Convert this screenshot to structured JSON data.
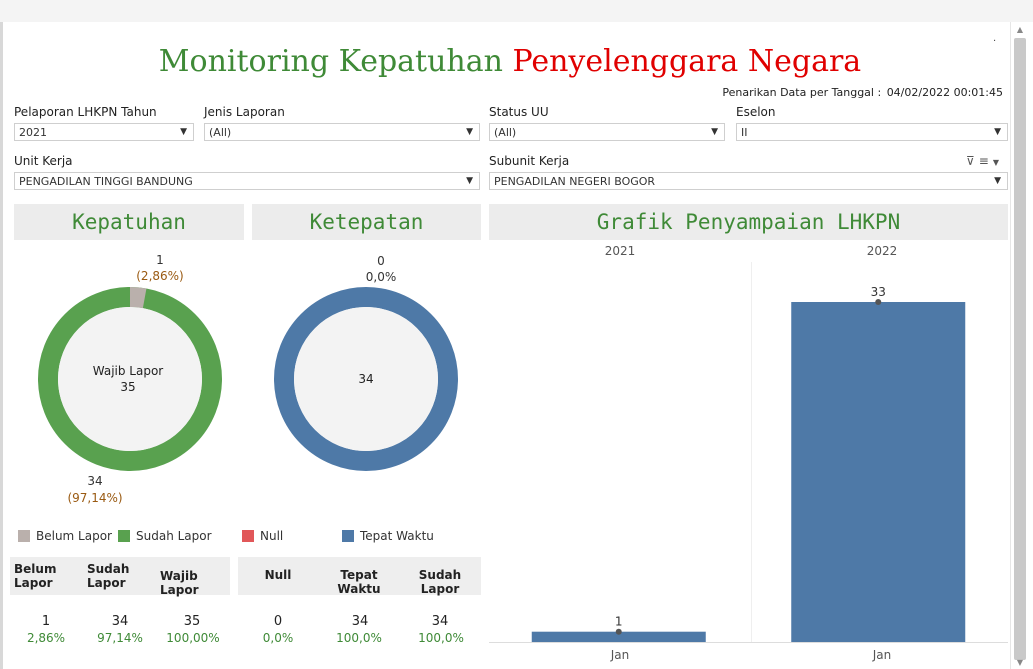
{
  "title": {
    "part1": "Monitoring Kepatuhan",
    "part2": "Penyelenggara Negara"
  },
  "timestamp": {
    "label": "Penarikan Data per Tanggal :",
    "value": "04/02/2022 00:01:45"
  },
  "filters": {
    "tahun": {
      "label": "Pelaporan LHKPN Tahun",
      "value": "2021"
    },
    "jenis": {
      "label": "Jenis Laporan",
      "value": "(All)"
    },
    "status": {
      "label": "Status UU",
      "value": "(All)"
    },
    "eselon": {
      "label": "Eselon",
      "value": "II"
    },
    "unit": {
      "label": "Unit Kerja",
      "value": "PENGADILAN TINGGI BANDUNG"
    },
    "subunit": {
      "label": "Subunit Kerja",
      "value": "PENGADILAN NEGERI BOGOR"
    }
  },
  "kepatuhan": {
    "title": "Kepatuhan",
    "center_label": "Wajib Lapor",
    "center_value": "35",
    "top_value": "1",
    "top_pct": "(2,86%)",
    "bottom_value": "34",
    "bottom_pct": "(97,14%)",
    "share_belum": 0.0286
  },
  "ketepatan": {
    "title": "Ketepatan",
    "top_value": "0",
    "top_pct": "0,0%",
    "center_value": "34"
  },
  "legend": {
    "belum": "Belum Lapor",
    "sudah": "Sudah Lapor",
    "null": "Null",
    "tepat": "Tepat Waktu"
  },
  "colors": {
    "green": "#59a14f",
    "grey": "#bab0ac",
    "red": "#e15759",
    "blue": "#4e79a7",
    "title_green": "#3f8a37",
    "title_red": "#e00000"
  },
  "table1": {
    "headers": [
      "Belum Lapor",
      "Sudah Lapor",
      "Wajib Lapor"
    ],
    "values": [
      "1",
      "34",
      "35"
    ],
    "pcts": [
      "2,86%",
      "97,14%",
      "100,00%"
    ]
  },
  "table2": {
    "headers": [
      "Null",
      "Tepat Waktu",
      "Sudah Lapor"
    ],
    "values": [
      "0",
      "34",
      "34"
    ],
    "pcts": [
      "0,0%",
      "100,0%",
      "100,0%"
    ]
  },
  "chart_data": {
    "type": "bar",
    "title": "Grafik Penyampaian LHKPN",
    "groups": [
      "2021",
      "2022"
    ],
    "categories": [
      "Jan",
      "Jan"
    ],
    "values": [
      1,
      33
    ],
    "labels": [
      "1",
      "33"
    ]
  }
}
